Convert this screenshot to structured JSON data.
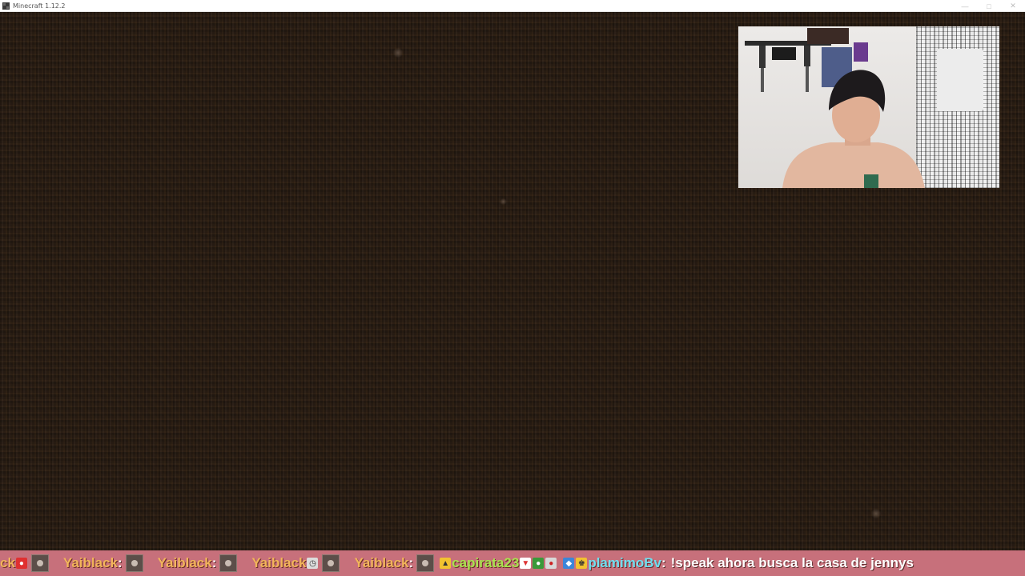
{
  "window": {
    "title": "Minecraft 1.12.2"
  },
  "icons": {
    "app": "minecraft-icon",
    "minimize": "minimize-icon",
    "maximize": "maximize-icon",
    "close": "close-icon"
  },
  "colors": {
    "dirt_background": "#2a1e14",
    "ticker_background": "#c7707b",
    "username_orange": "#f2b55a",
    "username_green": "#a8e34e",
    "username_cyan": "#6fe0f0",
    "message_text": "#ffffff"
  },
  "chat_ticker": {
    "items": [
      {
        "user": "ck",
        "sep": ""
      },
      {
        "user": "Yaiblack",
        "sep": " :"
      },
      {
        "user": "Yaiblack",
        "sep": " :"
      },
      {
        "user": "Yaiblack",
        "sep": ""
      },
      {
        "user": "Yaiblack",
        "sep": ":"
      },
      {
        "user": "capirata23",
        "sep": ""
      },
      {
        "user": "plamimoBv",
        "sep": " :"
      }
    ],
    "last_message": "!speak ahora busca la casa de jennys"
  }
}
